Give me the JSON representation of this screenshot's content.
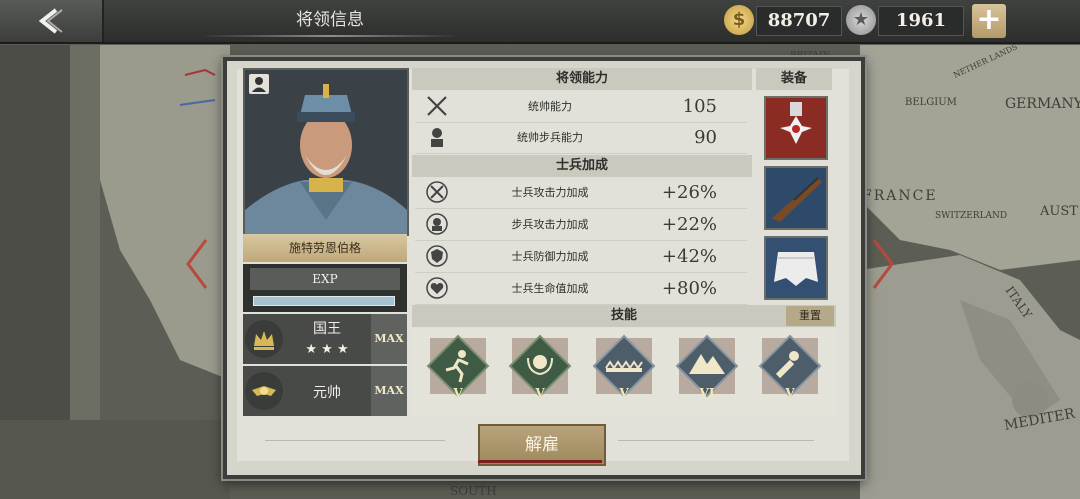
{
  "header": {
    "title": "将领信息",
    "gold": "88707",
    "medals": "1961",
    "add_label": "+"
  },
  "map_labels": [
    "GERMANY",
    "BELGIUM",
    "FRANCE",
    "SWITZERLAND",
    "AUST",
    "ITALY",
    "MEDITER",
    "SOUTH",
    "BRITAIN",
    "NETHER LANDS"
  ],
  "general": {
    "name": "施特劳恩伯格",
    "exp_label": "EXP",
    "exp_fraction": 0.0,
    "ranks": [
      {
        "title": "国王",
        "stars": "★ ★ ★",
        "max": "MAX"
      },
      {
        "title": "元帅",
        "max": "MAX"
      }
    ]
  },
  "abilities": {
    "header": "将领能力",
    "rows": [
      {
        "icon": "crossed-swords-icon",
        "label": "统帅能力",
        "value": "105"
      },
      {
        "icon": "infantry-icon",
        "label": "统帅步兵能力",
        "value": "90"
      }
    ]
  },
  "bonuses": {
    "header": "士兵加成",
    "rows": [
      {
        "icon": "attack-up-icon",
        "label": "士兵攻击力加成",
        "value": "+26%"
      },
      {
        "icon": "infantry-attack-icon",
        "label": "步兵攻击力加成",
        "value": "+22%"
      },
      {
        "icon": "shield-icon",
        "label": "士兵防御力加成",
        "value": "+42%"
      },
      {
        "icon": "heart-icon",
        "label": "士兵生命值加成",
        "value": "+80%"
      }
    ]
  },
  "equipment": {
    "header": "装备",
    "items": [
      "medal-cross",
      "rifle",
      "white-cloth"
    ]
  },
  "skills": {
    "header": "技能",
    "reset_label": "重置",
    "items": [
      {
        "icon": "running-soldier-icon",
        "level": "V",
        "color": "#3f5a45"
      },
      {
        "icon": "laurel-helmet-icon",
        "level": "V",
        "color": "#3f5a45"
      },
      {
        "icon": "barbed-wire-icon",
        "level": "V",
        "color": "#4d5d6a"
      },
      {
        "icon": "mountain-icon",
        "level": "VI",
        "color": "#4d5d6a"
      },
      {
        "icon": "artillery-shell-icon",
        "level": "V",
        "color": "#4d5d6a"
      }
    ]
  },
  "dismiss_label": "解雇"
}
